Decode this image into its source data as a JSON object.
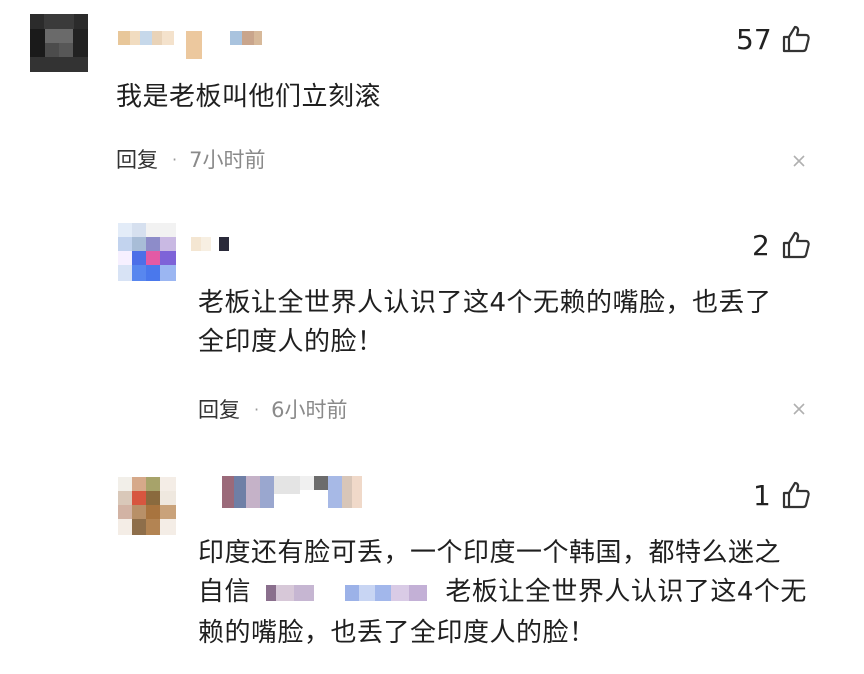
{
  "comments": [
    {
      "likes": "57",
      "text_lines": [
        "我是老板叫他们立刻滚"
      ],
      "reply_label": "回复",
      "dot": "·",
      "time": "7小时前"
    },
    {
      "likes": "2",
      "text_lines": [
        "老板让全世界人认识了这4个无赖的嘴脸，也丢了",
        "全印度人的脸！"
      ],
      "reply_label": "回复",
      "dot": "·",
      "time": "6小时前"
    },
    {
      "likes": "1",
      "text_lines": [
        "印度还有脸可丢，一个印度一个韩国，都特么迷之",
        "自信",
        "老板让全世界人认识了这4个无",
        "赖的嘴脸，也丢了全印度人的脸！"
      ]
    }
  ],
  "icons": {
    "like": "thumbs-up-icon",
    "dismiss": "close-icon"
  },
  "colors": {
    "text": "#1f1f1f",
    "meta": "#8a8a8a",
    "icon": "#333333"
  }
}
